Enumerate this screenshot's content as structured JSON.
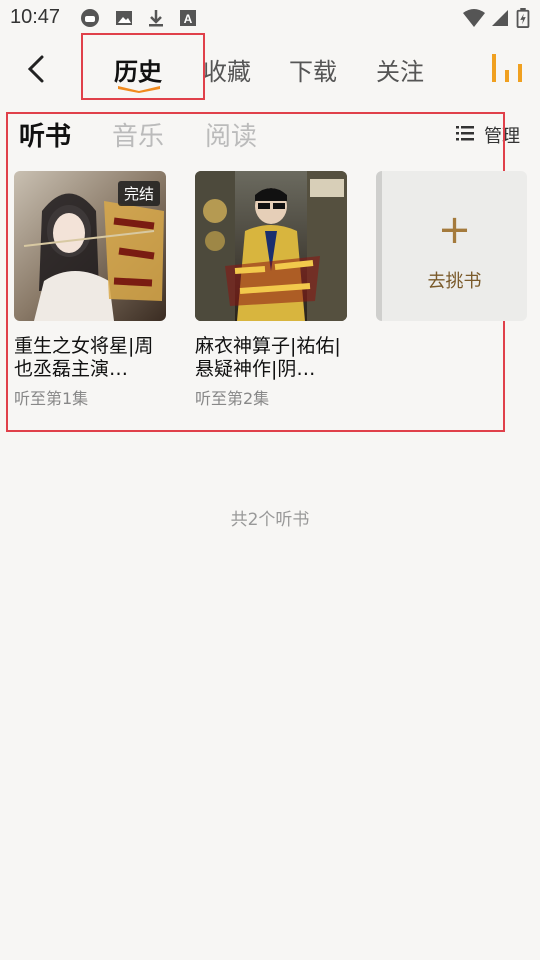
{
  "status_bar": {
    "time": "10:47",
    "icons": [
      "headset-icon",
      "image-icon",
      "download-icon",
      "text-a-icon",
      "wifi-icon",
      "signal-icon",
      "battery-icon"
    ]
  },
  "nav": {
    "tabs": [
      {
        "label": "历史",
        "active": true
      },
      {
        "label": "收藏",
        "active": false
      },
      {
        "label": "下载",
        "active": false
      },
      {
        "label": "关注",
        "active": false
      }
    ]
  },
  "subtabs": [
    {
      "label": "听书",
      "active": true
    },
    {
      "label": "音乐",
      "active": false
    },
    {
      "label": "阅读",
      "active": false
    }
  ],
  "manage_label": "管理",
  "books": [
    {
      "title": "重生之女将星|周也丞磊主演…",
      "progress": "听至第1集",
      "badge": "完结"
    },
    {
      "title": "麻衣神算子|祐佑|悬疑神作|阴…",
      "progress": "听至第2集",
      "badge": ""
    }
  ],
  "add_book": {
    "plus": "+",
    "label": "去挑书"
  },
  "total": "共2个听书",
  "colors": {
    "accent": "#f08a1e",
    "highlight_box": "#e0404a",
    "bg": "#f7f6f4"
  }
}
